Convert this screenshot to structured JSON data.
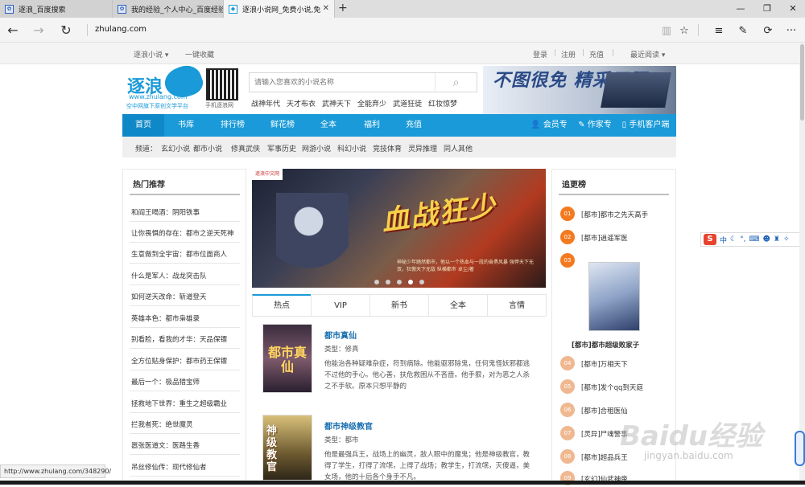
{
  "browser": {
    "tabs": [
      {
        "title": "逐浪_百度搜索",
        "active": false
      },
      {
        "title": "我的经验_个人中心_百度经验",
        "active": false
      },
      {
        "title": "逐浪小说网_免费小说,免",
        "active": true
      }
    ],
    "url": "zhulang.com",
    "status_url": "http://www.zhulang.com/348290/"
  },
  "site_bar": {
    "brand_menu": "逐浪小说",
    "bookmark": "一键收藏",
    "login": "登录",
    "register": "注册",
    "recharge": "充值",
    "recent": "最近阅读"
  },
  "header": {
    "logo": "逐浪",
    "domain": "www.zhulang.com",
    "slogan": "空中网旗下原创文学平台",
    "qr_label": "手机逐浪网",
    "search_placeholder": "请输入您喜欢的小说名称",
    "hot_searches": [
      "战神年代",
      "天才布衣",
      "武神天下",
      "全能弃少",
      "武道狂徒",
      "红妆惊梦"
    ],
    "banner_text": "不图很免 精采无限"
  },
  "nav": {
    "items": [
      "首页",
      "书库",
      "排行榜",
      "鲜花榜",
      "全本",
      "福利",
      "充值"
    ],
    "right_items": [
      "会员专区",
      "作家专区",
      "手机客户端"
    ]
  },
  "categories": {
    "label": "频道：",
    "items": [
      "玄幻小说",
      "都市小说",
      "修真武侠",
      "军事历史",
      "网游小说",
      "科幻小说",
      "竞技体育",
      "灵异推理",
      "同人其他"
    ]
  },
  "hot_recommend": {
    "title": "热门推荐",
    "items": [
      "和阎王喝酒：阴阳铁事",
      "让你畏惧的存在：都市之逆天死神",
      "生意做到全宇宙：都市位面商人",
      "什么是军人：战龙突击队",
      "如何逆天改命：斩道登天",
      "英雄本色：都市枭雄录",
      "别看脸，看我的才华：天品保镖",
      "全方位贴身保护：都市药王保镖",
      "最后一个：极品猎宝师",
      "拯救地下世界：重生之超级霸业",
      "拦我者死：绝世魔灵",
      "嚣张医道文：医路生香",
      "吊丝修仙传：现代修仙者"
    ]
  },
  "carousel": {
    "tag": "逐浪中文网",
    "title": "血战狂少",
    "caption": "神秘少年踏然都市，他以一个热血与一段的奋勇风暴 强悍天下无双，狂傲天下无敌 纵横都市 卓尘/著",
    "dots": 5,
    "active_dot": 4
  },
  "content_tabs": [
    "热点",
    "VIP",
    "新书",
    "全本",
    "言情"
  ],
  "books": [
    {
      "title": "都市真仙",
      "type": "类型：修真",
      "desc": "他能治各种疑难杂症，符到病除。他能驱邪除鬼，任何鬼怪妖邪都逃不过他的手心。他心善，扶危救困从不吝啬。他手狠，对为恶之人杀之不手软。原本只想平静的",
      "cover_text": "都市真仙"
    },
    {
      "title": "都市神级教官",
      "type": "类型：都市",
      "desc": "他是最强兵王，战场上的幽灵，敌人眼中的魔鬼；他是神级教官，教得了学生，打得了流氓，上得了战场；教学生，打流氓，灭傻逼，美女场，他的十后各个身手不凡。",
      "cover_text": "神级教官"
    }
  ],
  "chase_rank": {
    "title": "追更榜",
    "items": [
      {
        "num": "01",
        "text": "[都市]都市之先天高手"
      },
      {
        "num": "02",
        "text": "[都市]逍遥军医"
      },
      {
        "num": "03",
        "text": ""
      },
      {
        "num": "04",
        "text": "[都市]万相天下"
      },
      {
        "num": "05",
        "text": "[都市]发个qq到天庭"
      },
      {
        "num": "06",
        "text": "[都市]合租医仙"
      },
      {
        "num": "07",
        "text": "[灵异]尸魂警事"
      },
      {
        "num": "08",
        "text": "[都市]超品兵王"
      },
      {
        "num": "09",
        "text": "[玄幻]仙武神帝"
      }
    ],
    "featured_title": "[都市]都市超级败家子"
  },
  "ime": {
    "label": "中"
  },
  "watermark": {
    "brand": "Baidu经验",
    "url": "jingyan.baidu.com"
  }
}
